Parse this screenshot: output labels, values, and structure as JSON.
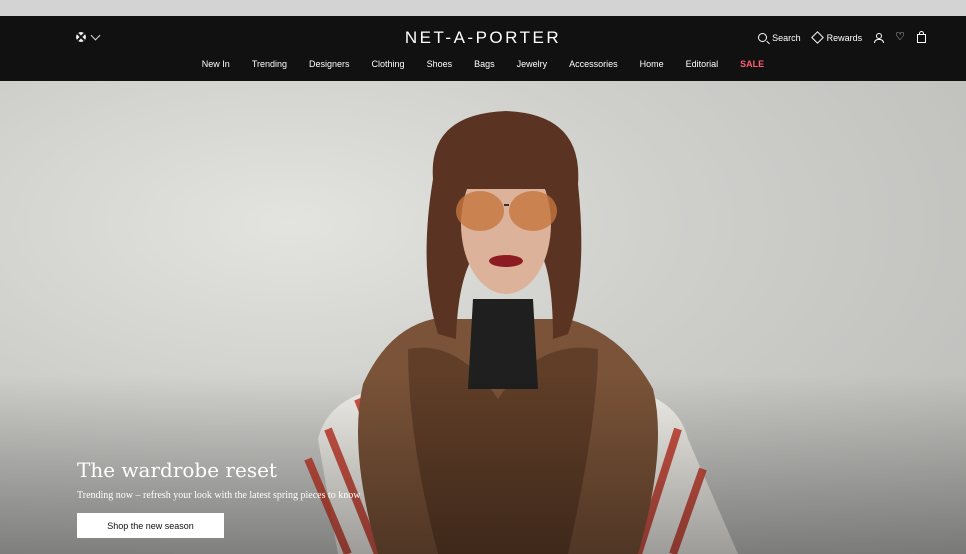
{
  "header": {
    "brand": "NET-A-PORTER",
    "locale_icon": "flag-globe-icon",
    "utils": {
      "search_label": "Search",
      "rewards_label": "Rewards"
    },
    "nav": [
      "New In",
      "Trending",
      "Designers",
      "Clothing",
      "Shoes",
      "Bags",
      "Jewelry",
      "Accessories",
      "Home",
      "Editorial",
      "SALE"
    ]
  },
  "hero": {
    "title": "The wardrobe reset",
    "subtitle": "Trending now – refresh your look with the latest spring pieces to know",
    "cta": "Shop the new season"
  },
  "colors": {
    "header_bg": "#111111",
    "sale": "#ff5c6e",
    "cta_bg": "#ffffff"
  }
}
